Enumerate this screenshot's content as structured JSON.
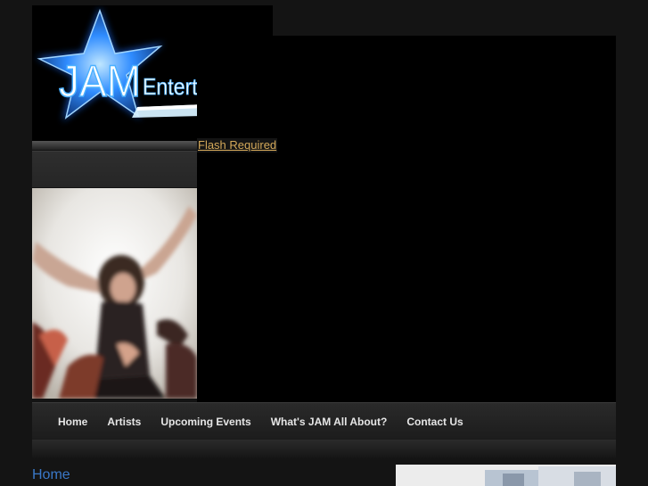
{
  "logo": {
    "wordmark_main": "JAM",
    "wordmark_sub": "Entertainment",
    "glow_color": "#3aa0ff"
  },
  "flash": {
    "link_text": "Flash Required"
  },
  "nav": {
    "items": [
      {
        "label": "Home"
      },
      {
        "label": "Artists"
      },
      {
        "label": "Upcoming Events"
      },
      {
        "label": "What's JAM All About?"
      },
      {
        "label": "Contact Us"
      }
    ]
  },
  "main": {
    "title": "Home"
  },
  "colors": {
    "background": "#141414",
    "link": "#d4a95a",
    "title": "#3a78c8"
  }
}
